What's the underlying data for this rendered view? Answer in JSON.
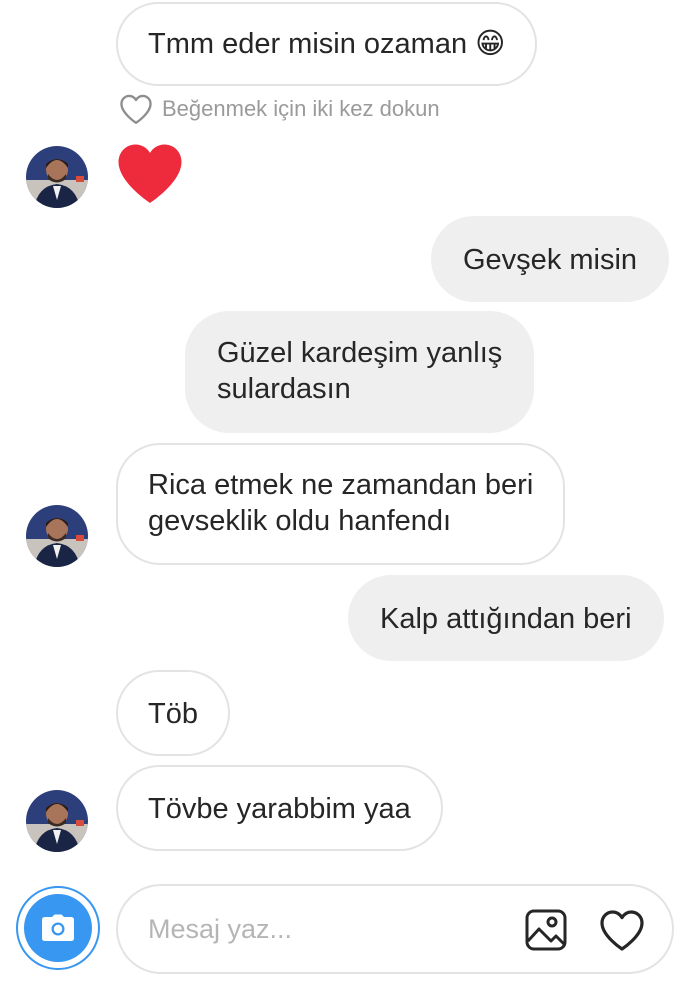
{
  "messages": [
    {
      "direction": "in",
      "lines": [
        "Tmm eder misin ozaman 😁"
      ]
    },
    {
      "direction": "out",
      "lines": [
        "Gevşek misin"
      ]
    },
    {
      "direction": "out",
      "lines": [
        "Güzel kardeşim yanlış",
        "sulardasın"
      ]
    },
    {
      "direction": "in",
      "lines": [
        "Rica etmek ne zamandan beri",
        "gevseklik oldu hanfendı"
      ]
    },
    {
      "direction": "out",
      "lines": [
        "Kalp attığından beri"
      ]
    },
    {
      "direction": "in",
      "lines": [
        "Töb"
      ]
    },
    {
      "direction": "in",
      "lines": [
        "Tövbe yarabbim yaa"
      ]
    }
  ],
  "like_hint": "Beğenmek için iki kez dokun",
  "reaction": {
    "icon": "heart-icon",
    "color": "#ed2b3c"
  },
  "composer": {
    "placeholder": "Mesaj yaz...",
    "camera_icon": "camera-icon",
    "gallery_icon": "gallery-icon",
    "like_icon": "heart-outline-icon",
    "accent": "#3897f0"
  }
}
